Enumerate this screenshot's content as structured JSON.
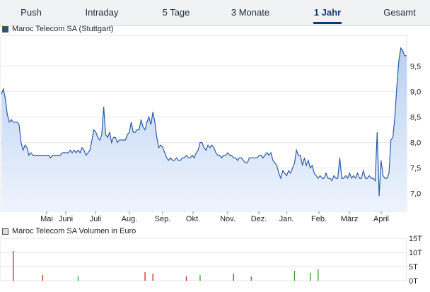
{
  "tabs": [
    {
      "label": "Push",
      "active": false
    },
    {
      "label": "Intraday",
      "active": false
    },
    {
      "label": "5 Tage",
      "active": false
    },
    {
      "label": "3 Monate",
      "active": false
    },
    {
      "label": "1 Jahr",
      "active": true
    },
    {
      "label": "Gesamt",
      "active": false
    }
  ],
  "price_legend": "Maroc Telecom SA (Stuttgart)",
  "volume_legend": "Maroc Telecom SA Volumen in Euro",
  "colors": {
    "line": "#2b5aa8",
    "fill_top": "#b9d0f3",
    "fill_bottom": "#eef4fd",
    "vol_red": "#d02020",
    "vol_green": "#2aa02a",
    "grid": "#e4e6e9",
    "legend_price": "#2b4f8a",
    "legend_volume": "#dddddd"
  },
  "chart_data": [
    {
      "type": "area",
      "x_tick_labels": [
        "Mai",
        "Juni",
        "Juli",
        "Aug.",
        "Sep.",
        "Okt.",
        "Nov.",
        "Dez.",
        "Jan.",
        "Feb.",
        "März",
        "April"
      ],
      "y_ticks": [
        7.0,
        7.5,
        8.0,
        8.5,
        9.0,
        9.5
      ],
      "y_tick_labels": [
        "7,0",
        "7,5",
        "8,0",
        "8,5",
        "9,0",
        "9,5"
      ],
      "ylim": [
        6.65,
        10.1
      ],
      "grid": true,
      "series": [
        {
          "name": "Maroc Telecom SA (Stuttgart)",
          "values": [
            8.95,
            9.05,
            8.85,
            8.55,
            8.4,
            8.45,
            8.4,
            8.4,
            8.4,
            8.35,
            8.0,
            7.85,
            7.95,
            7.9,
            7.75,
            7.8,
            7.75,
            7.75,
            7.75,
            7.75,
            7.75,
            7.75,
            7.75,
            7.75,
            7.75,
            7.7,
            7.75,
            7.75,
            7.75,
            7.75,
            7.75,
            7.8,
            7.8,
            7.8,
            7.8,
            7.85,
            7.8,
            7.85,
            7.8,
            7.85,
            7.8,
            7.9,
            7.85,
            7.75,
            7.8,
            7.85,
            8.05,
            8.25,
            8.2,
            8.1,
            8.05,
            8.15,
            8.7,
            8.15,
            8.1,
            8.2,
            8.0,
            8.1,
            8.1,
            8.0,
            8.05,
            8.05,
            8.05,
            8.05,
            8.15,
            8.2,
            8.4,
            8.2,
            8.2,
            8.25,
            8.25,
            8.45,
            8.3,
            8.25,
            8.4,
            8.5,
            8.35,
            8.6,
            8.4,
            8.1,
            7.9,
            7.95,
            7.9,
            7.8,
            7.7,
            7.65,
            7.7,
            7.65,
            7.65,
            7.7,
            7.65,
            7.65,
            7.7,
            7.7,
            7.75,
            7.7,
            7.7,
            7.75,
            7.7,
            7.8,
            7.85,
            8.0,
            8.0,
            7.9,
            7.85,
            7.95,
            7.9,
            7.95,
            7.9,
            7.8,
            7.75,
            7.75,
            7.7,
            7.75,
            7.75,
            7.8,
            7.75,
            7.75,
            7.7,
            7.7,
            7.65,
            7.7,
            7.7,
            7.65,
            7.6,
            7.6,
            7.7,
            7.7,
            7.7,
            7.7,
            7.7,
            7.75,
            7.75,
            7.7,
            7.75,
            7.8,
            7.75,
            7.8,
            7.65,
            7.6,
            7.55,
            7.4,
            7.3,
            7.45,
            7.4,
            7.35,
            7.45,
            7.4,
            7.5,
            7.6,
            7.85,
            7.75,
            7.75,
            7.55,
            7.7,
            7.55,
            7.65,
            7.5,
            7.55,
            7.4,
            7.35,
            7.3,
            7.35,
            7.3,
            7.3,
            7.4,
            7.3,
            7.3,
            7.25,
            7.35,
            7.3,
            7.3,
            7.7,
            7.3,
            7.3,
            7.35,
            7.3,
            7.4,
            7.3,
            7.35,
            7.3,
            7.4,
            7.3,
            7.3,
            7.45,
            7.3,
            7.3,
            7.35,
            7.3,
            7.3,
            7.25,
            8.2,
            6.95,
            7.65,
            7.35,
            7.3,
            7.3,
            7.4,
            8.05,
            8.1,
            8.5,
            9.1,
            9.6,
            9.85,
            9.8,
            9.7,
            9.7
          ]
        }
      ]
    },
    {
      "type": "bar",
      "y_ticks": [
        0,
        5,
        10,
        15
      ],
      "y_tick_labels": [
        "0T",
        "5T",
        "10T",
        "15T"
      ],
      "ylim": [
        0,
        15
      ],
      "grid": true,
      "series": [
        {
          "color_key": "vol_red",
          "points": [
            [
              6,
              10.5
            ],
            [
              21,
              2
            ],
            [
              73,
              3
            ],
            [
              77,
              2.5
            ],
            [
              94,
              1.5
            ],
            [
              118,
              2.5
            ]
          ]
        },
        {
          "color_key": "vol_green",
          "points": [
            [
              39,
              1.5
            ],
            [
              101,
              2
            ],
            [
              127,
              1.5
            ],
            [
              149,
              3.5
            ],
            [
              157,
              2.8
            ],
            [
              161,
              4
            ]
          ]
        }
      ]
    }
  ]
}
